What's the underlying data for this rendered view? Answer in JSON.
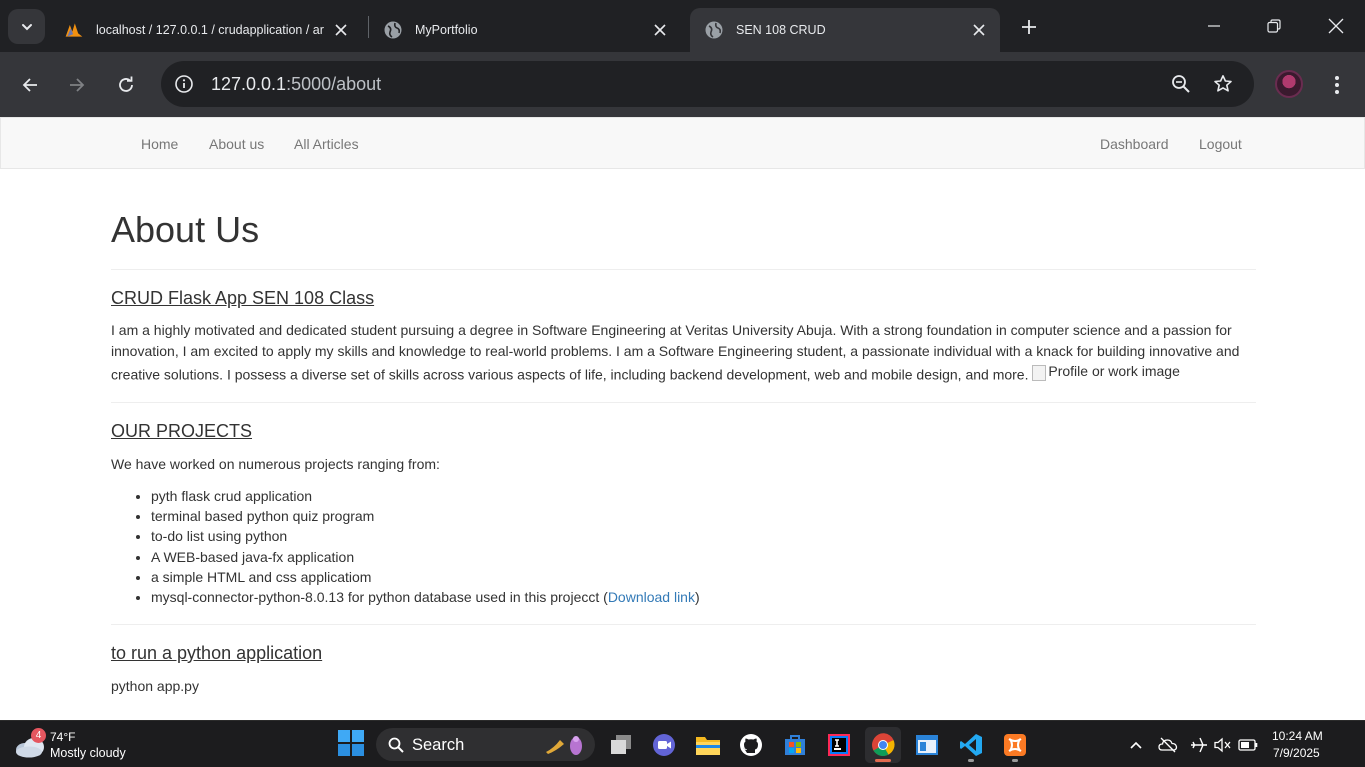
{
  "browser": {
    "tabs": [
      {
        "title": "localhost / 127.0.0.1 / crudapplication / ar",
        "favicon": "phpmyadmin-icon",
        "active": false
      },
      {
        "title": "MyPortfolio",
        "favicon": "globe-icon",
        "active": false
      },
      {
        "title": "SEN 108 CRUD",
        "favicon": "globe-icon",
        "active": true
      }
    ],
    "url_host": "127.0.0.1",
    "url_path": ":5000/about"
  },
  "page": {
    "nav_left": [
      "Home",
      "About us",
      "All Articles"
    ],
    "nav_right": [
      "Dashboard",
      "Logout"
    ],
    "title": "About Us",
    "section1": {
      "heading": "CRUD Flask App SEN 108 Class",
      "paragraph": "I am a highly motivated and dedicated student pursuing a degree in Software Engineering at Veritas University Abuja. With a strong foundation in computer science and a passion for innovation, I am excited to apply my skills and knowledge to real-world problems. I am a Software Engineering student, a passionate individual with a knack for building innovative and creative solutions. I possess a diverse set of skills across various aspects of life, including backend development, web and mobile design, and more.",
      "image_alt": "Profile or work image"
    },
    "section2": {
      "heading": "OUR PROJECTS",
      "intro": "We have worked on numerous projects ranging from:",
      "items": [
        "pyth flask crud application",
        "terminal based python quiz program",
        "to-do list using python",
        "A WEB-based java-fx application",
        "a simple HTML and css applicatiom"
      ],
      "last_item_text": "mysql-connector-python-8.0.13 for python database used in this projecct (",
      "last_item_link": "Download link",
      "last_item_close": ")"
    },
    "section3": {
      "heading": "to run a python application",
      "command": "python app.py"
    }
  },
  "taskbar": {
    "weather_badge": "4",
    "weather_temp": "74°F",
    "weather_condition": "Mostly cloudy",
    "search_label": "Search",
    "clock_time": "10:24 AM",
    "clock_date": "7/9/2025"
  },
  "colors": {
    "link": "#337ab7",
    "nav_text": "#777777",
    "tab_active": "#35363a",
    "taskbar": "#1c1c1e"
  }
}
